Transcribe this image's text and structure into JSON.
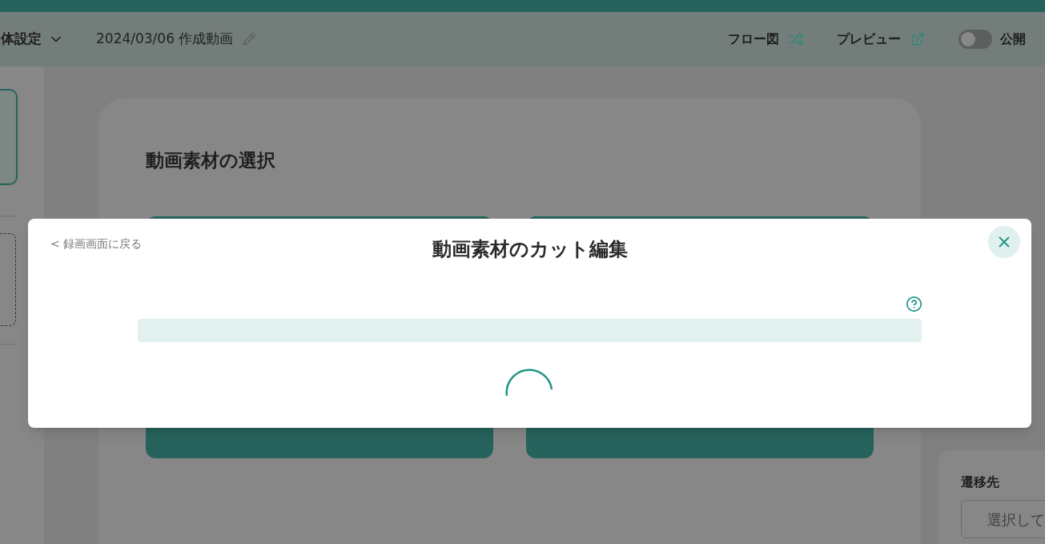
{
  "header": {
    "menu_label": "体設定",
    "project_title": "2024/03/06 作成動画",
    "actions": [
      {
        "label": "フロー図",
        "kind": "flow"
      },
      {
        "label": "プレビュー",
        "kind": "preview"
      }
    ],
    "publish": {
      "label": "公開",
      "on": false
    }
  },
  "main": {
    "section_title": "動画素材の選択"
  },
  "side_panel": {
    "label": "遷移先",
    "select_placeholder": "選択して"
  },
  "modal": {
    "back_link": "< 録画画面に戻る",
    "title": "動画素材のカット編集"
  }
}
